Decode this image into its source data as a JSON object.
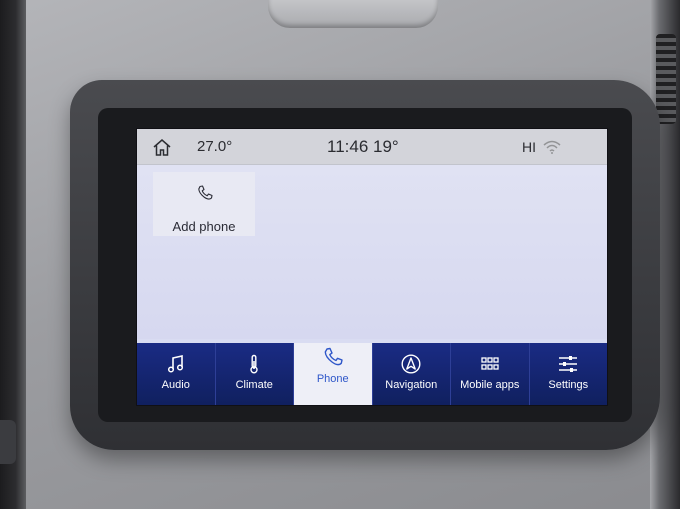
{
  "status_bar": {
    "cabin_temperature": "27.0°",
    "clock": "11:46",
    "outside_temperature": "19°",
    "user": "HI"
  },
  "content": {
    "add_phone_label": "Add phone"
  },
  "nav": {
    "items": [
      {
        "label": "Audio",
        "icon": "music-note-icon"
      },
      {
        "label": "Climate",
        "icon": "thermometer-icon"
      },
      {
        "label": "Phone",
        "icon": "phone-icon"
      },
      {
        "label": "Navigation",
        "icon": "navigation-icon"
      },
      {
        "label": "Mobile apps",
        "icon": "apps-grid-icon"
      },
      {
        "label": "Settings",
        "icon": "sliders-icon"
      }
    ],
    "active": "Phone"
  },
  "colors": {
    "nav_background": "#1a2b84",
    "nav_active_background": "#eeeff7",
    "nav_active_text": "#2f57c9",
    "content_background": "#d9dcf2",
    "status_bar_background": "#d3d4da"
  }
}
